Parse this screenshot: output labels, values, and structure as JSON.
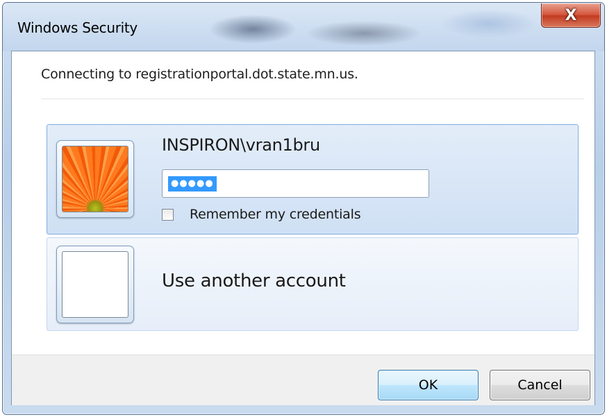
{
  "window": {
    "title": "Windows Security",
    "close_label": "X"
  },
  "message": {
    "connecting": "Connecting to registrationportal.dot.state.mn.us."
  },
  "credential_tiles": [
    {
      "username": "INSPIRON\\vran1bru",
      "avatar": "orange-flower-picture",
      "password_masked": "●●●●●",
      "password_selected": true,
      "remember_label": "Remember my credentials",
      "remember_checked": false,
      "selected": true
    },
    {
      "label": "Use another account",
      "avatar": "blank-picture"
    }
  ],
  "buttons": {
    "ok": "OK",
    "cancel": "Cancel"
  },
  "colors": {
    "selection": "#3399ff",
    "tile_selected": "#cfe0f4",
    "close_button": "#c23a1f"
  }
}
